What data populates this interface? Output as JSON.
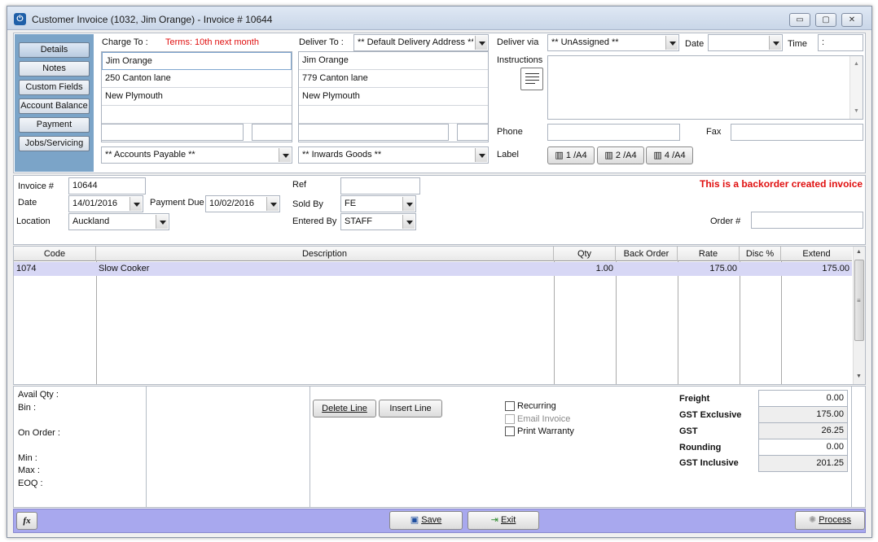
{
  "window": {
    "title": "Customer Invoice (1032, Jim Orange) - Invoice # 10644",
    "minimize": "▭",
    "maximize": "▢",
    "close": "✕"
  },
  "nav": {
    "items": [
      "Details",
      "Notes",
      "Custom Fields",
      "Account Balance",
      "Payment",
      "Jobs/Servicing"
    ]
  },
  "charge_to": {
    "label": "Charge To :",
    "terms": "Terms: 10th next month",
    "lines": [
      "Jim Orange",
      "250 Canton lane",
      "New Plymouth",
      "",
      ""
    ],
    "account": "** Accounts Payable **"
  },
  "deliver_to": {
    "label": "Deliver To :",
    "address_select": "** Default Delivery Address **",
    "lines": [
      "Jim Orange",
      "779 Canton lane",
      "New Plymouth",
      "",
      ""
    ],
    "goods": "** Inwards Goods **"
  },
  "delivery": {
    "via_label": "Deliver via",
    "via_value": "** UnAssigned **",
    "date_label": "Date",
    "date_value": "",
    "time_label": "Time",
    "time_value": ":",
    "instructions_label": "Instructions",
    "phone_label": "Phone",
    "phone_value": "",
    "fax_label": "Fax",
    "fax_value": "",
    "label_label": "Label",
    "label_buttons": [
      "1 /A4",
      "2 /A4",
      "4 /A4"
    ]
  },
  "invoice": {
    "number_label": "Invoice #",
    "number": "10644",
    "date_label": "Date",
    "date": "14/01/2016",
    "payment_due_label": "Payment Due",
    "payment_due": "10/02/2016",
    "location_label": "Location",
    "location": "Auckland",
    "ref_label": "Ref",
    "ref": "",
    "sold_by_label": "Sold By",
    "sold_by": "FE",
    "entered_by_label": "Entered By",
    "entered_by": "STAFF",
    "backorder_notice": "This is a backorder created invoice",
    "order_label": "Order #",
    "order": ""
  },
  "lines": {
    "columns": [
      "Code",
      "Description",
      "Qty",
      "Back Order",
      "Rate",
      "Disc %",
      "Extend"
    ],
    "rows": [
      {
        "code": "1074",
        "description": "Slow Cooker",
        "qty": "1.00",
        "back_order": "",
        "rate": "175.00",
        "disc": "",
        "extend": "175.00"
      }
    ]
  },
  "stock": {
    "avail_qty": "Avail Qty :",
    "bin": "Bin :",
    "on_order": "On Order :",
    "min": "Min :",
    "max": "Max :",
    "eoq": "EOQ :"
  },
  "line_actions": {
    "delete": "Delete Line",
    "insert": "Insert Line"
  },
  "options": {
    "recurring": "Recurring",
    "email_invoice": "Email Invoice",
    "print_warranty": "Print Warranty"
  },
  "totals": {
    "freight_label": "Freight",
    "freight": "0.00",
    "gst_exclusive_label": "GST Exclusive",
    "gst_exclusive": "175.00",
    "gst_label": "GST",
    "gst": "26.25",
    "rounding_label": "Rounding",
    "rounding": "0.00",
    "gst_inclusive_label": "GST Inclusive",
    "gst_inclusive": "201.25"
  },
  "footer": {
    "fx": "fx",
    "save": "Save",
    "exit": "Exit",
    "process": "Process"
  },
  "colors": {
    "nav_panel": "#7ba4c8",
    "footer_bar": "#a8a8ee",
    "selected_row": "#d7d7f5",
    "backorder_text": "#e01010",
    "terms_text": "#e01010"
  }
}
